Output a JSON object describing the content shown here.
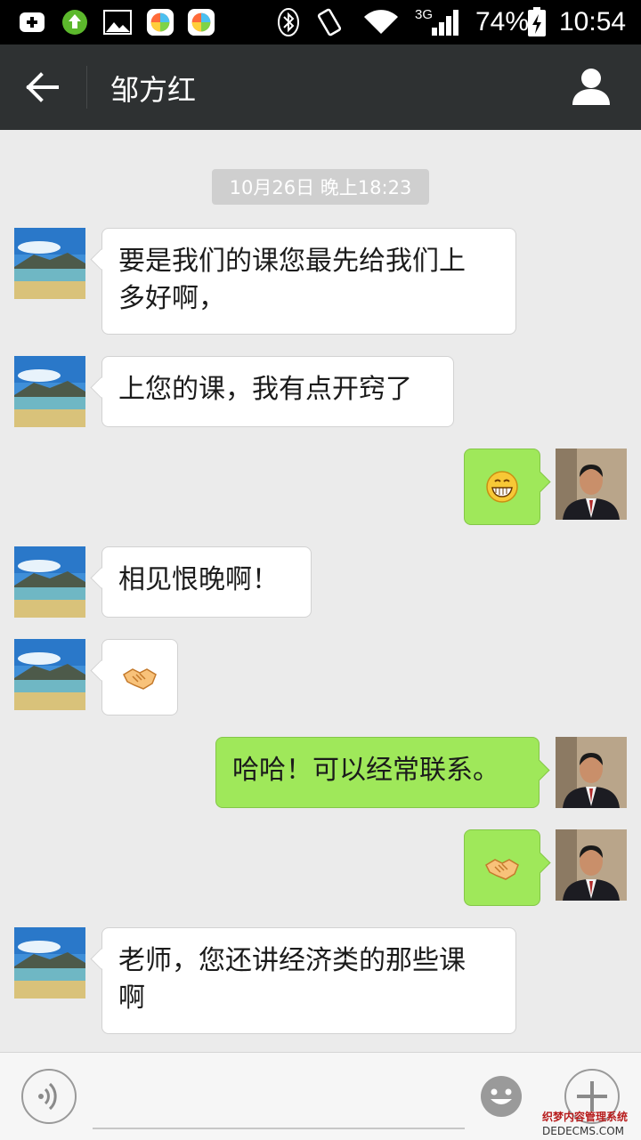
{
  "status_bar": {
    "network": "3G",
    "battery": "74%",
    "time": "10:54"
  },
  "header": {
    "title": "邹方红"
  },
  "chat": {
    "timestamp": "10月26日 晚上18:23",
    "messages": [
      {
        "from": "them",
        "text": "要是我们的课您最先给我们上\n多好啊，"
      },
      {
        "from": "them",
        "text": "上您的课，我有点开窍了"
      },
      {
        "from": "me",
        "emoji": "grin-emoji"
      },
      {
        "from": "them",
        "text": "相见恨晚啊！"
      },
      {
        "from": "them",
        "emoji": "handshake-emoji"
      },
      {
        "from": "me",
        "text": "哈哈！可以经常联系。"
      },
      {
        "from": "me",
        "emoji": "handshake-emoji"
      },
      {
        "from": "them",
        "text": "老师，您还讲经济类的那些课\n啊"
      }
    ]
  },
  "input_bar": {
    "icons": [
      "voice-icon",
      "emoji-icon",
      "plus-icon"
    ]
  },
  "watermark": "织梦内容管理系统 DEDECMS.COM",
  "colors": {
    "status_bar": "#000000",
    "title_bar": "#2e3132",
    "chat_bg": "#ebebeb",
    "bubble_in": "#ffffff",
    "bubble_out": "#9fe85a"
  }
}
